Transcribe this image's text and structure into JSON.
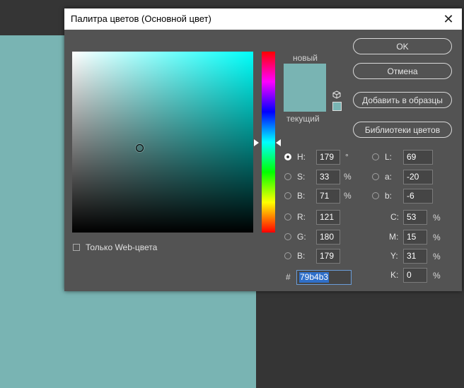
{
  "dialog": {
    "title": "Палитра цветов (Основной цвет)",
    "close_icon": "close-icon"
  },
  "preview": {
    "new_label": "новый",
    "current_label": "текущий",
    "new_color": "#79b4b3",
    "current_color": "#79b4b3"
  },
  "buttons": {
    "ok": "OK",
    "cancel": "Отмена",
    "add_swatch": "Добавить в образцы",
    "libraries": "Библиотеки цветов"
  },
  "web_only": {
    "label": "Только Web-цвета",
    "checked": false
  },
  "hsb": {
    "h": {
      "label": "H:",
      "value": "179",
      "unit": "°",
      "selected": true
    },
    "s": {
      "label": "S:",
      "value": "33",
      "unit": "%"
    },
    "b": {
      "label": "B:",
      "value": "71",
      "unit": "%"
    }
  },
  "rgb": {
    "r": {
      "label": "R:",
      "value": "121"
    },
    "g": {
      "label": "G:",
      "value": "180"
    },
    "b": {
      "label": "B:",
      "value": "179"
    }
  },
  "lab": {
    "l": {
      "label": "L:",
      "value": "69"
    },
    "a": {
      "label": "a:",
      "value": "-20"
    },
    "b": {
      "label": "b:",
      "value": "-6"
    }
  },
  "cmyk": {
    "c": {
      "label": "C:",
      "value": "53",
      "unit": "%"
    },
    "m": {
      "label": "M:",
      "value": "15",
      "unit": "%"
    },
    "y": {
      "label": "Y:",
      "value": "31",
      "unit": "%"
    },
    "k": {
      "label": "K:",
      "value": "0",
      "unit": "%"
    }
  },
  "hex": {
    "prefix": "#",
    "value": "79b4b3"
  },
  "colors": {
    "accent": "#79b4b3",
    "dialog_bg": "#535353",
    "selection": "#2f6fc9"
  }
}
